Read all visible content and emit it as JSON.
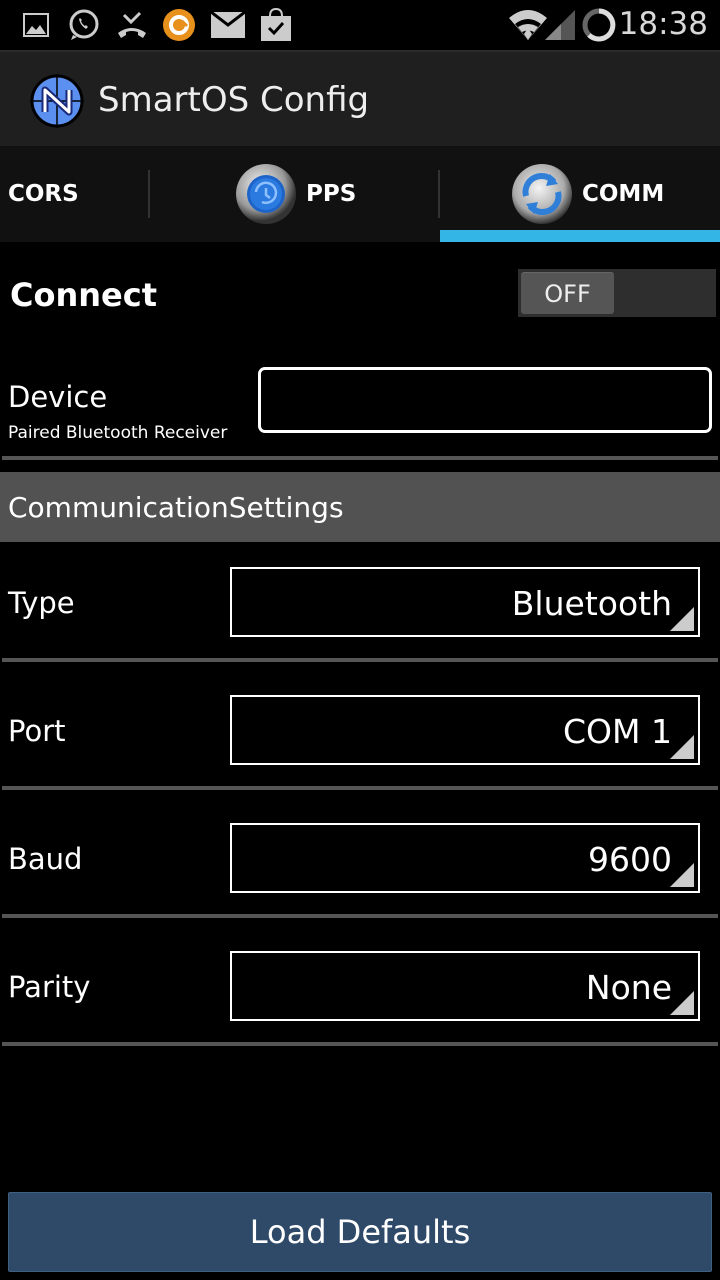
{
  "status_bar": {
    "time": "18:38",
    "notification_icons": [
      "gallery-icon",
      "whatsapp-icon",
      "missed-call-icon",
      "orange-app-icon",
      "email-icon",
      "play-store-update-icon"
    ],
    "system_icons": [
      "wifi-icon",
      "signal-icon",
      "battery-ring-icon"
    ]
  },
  "action_bar": {
    "title": "SmartOS Config",
    "logo_icon": "compass-n-logo-icon"
  },
  "tabs": [
    {
      "label": "CORS",
      "active": false
    },
    {
      "label": "PPS",
      "icon": "clock-history-icon",
      "active": false
    },
    {
      "label": "COMM",
      "icon": "sync-icon",
      "active": true
    }
  ],
  "accent_color": "#33b5e5",
  "connect": {
    "label": "Connect",
    "toggle_state": "OFF"
  },
  "device": {
    "label": "Device",
    "sublabel": "Paired Bluetooth Receiver",
    "value": ""
  },
  "section": {
    "title": "CommunicationSettings"
  },
  "settings": [
    {
      "label": "Type",
      "value": "Bluetooth"
    },
    {
      "label": "Port",
      "value": "COM 1"
    },
    {
      "label": "Baud",
      "value": "9600"
    },
    {
      "label": "Parity",
      "value": "None"
    }
  ],
  "load_defaults": {
    "label": "Load Defaults"
  }
}
